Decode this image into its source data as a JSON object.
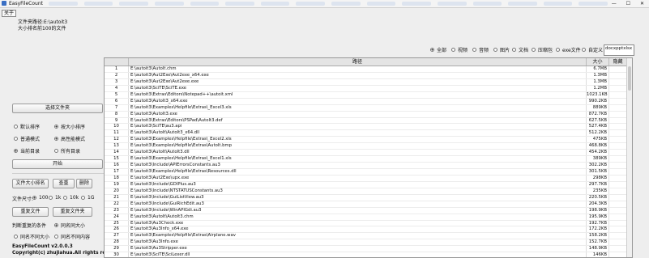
{
  "window": {
    "title": "EasyFileCount",
    "controls": [
      "—",
      "☐",
      "✕"
    ]
  },
  "menu": {
    "about": "关于"
  },
  "info": {
    "line1": "文件夹路径:E:\\autoit3",
    "line2": "大小排名前100的文件"
  },
  "left": {
    "select_folder": "选择文件夹",
    "sort_options": [
      {
        "label": "默认排序",
        "checked": false
      },
      {
        "label": "按大小排序",
        "checked": true
      }
    ],
    "mode_options": [
      {
        "label": "普通模式",
        "checked": false
      },
      {
        "label": "高性能模式",
        "checked": true
      }
    ],
    "scope_options": [
      {
        "label": "当前目录",
        "checked": true
      },
      {
        "label": "所有目录",
        "checked": false
      }
    ],
    "start": "开始",
    "size_rank": "文件大小排名",
    "dedupe": "查重",
    "delete": "删除",
    "file_size_label": "文件尺寸:",
    "size_options": [
      {
        "label": "100",
        "checked": true
      },
      {
        "label": "1k",
        "checked": false
      },
      {
        "label": "10k",
        "checked": false
      },
      {
        "label": "1G",
        "checked": false
      }
    ],
    "duplicate_files": "重复文件",
    "duplicate_folders": "重复文件夹",
    "dup_condition": "判断重复的条件",
    "dup_options": [
      {
        "label": "同名同大小",
        "checked": true
      },
      {
        "label": "同名不同大小",
        "checked": false
      },
      {
        "label": "同名不同内容",
        "checked": false
      }
    ],
    "version": "EasyFileCount v2.0.0.3",
    "copyright": "Copyright(c) zhujiahua.All rights reserved."
  },
  "filters": [
    {
      "label": "全部",
      "checked": true
    },
    {
      "label": "视频",
      "checked": false
    },
    {
      "label": "音频",
      "checked": false
    },
    {
      "label": "图片",
      "checked": false
    },
    {
      "label": "文档",
      "checked": false
    },
    {
      "label": "压缩包",
      "checked": false
    },
    {
      "label": "exe文件",
      "checked": false
    },
    {
      "label": "自定义",
      "checked": false
    }
  ],
  "ext_input": "docxpptxlsx",
  "table": {
    "headers": [
      "",
      "路径",
      "大小",
      "隐藏"
    ],
    "rows": [
      [
        "1",
        "E:\\autoit3\\AutoIt.chm",
        "6.7MB"
      ],
      [
        "2",
        "E:\\autoit3\\Aut2Exe\\Aut2exe_x64.exe",
        "1.3MB"
      ],
      [
        "3",
        "E:\\autoit3\\Aut2Exe\\Aut2exe.exe",
        "1.3MB"
      ],
      [
        "4",
        "E:\\autoit3\\SciTE\\SciTE.exe",
        "1.2MB"
      ],
      [
        "5",
        "E:\\autoit3\\Extras\\Editors\\Notepad++\\autoit.xml",
        "1023.1KB"
      ],
      [
        "6",
        "E:\\autoit3\\AutoIt3_x64.exe",
        "990.2KB"
      ],
      [
        "7",
        "E:\\autoit3\\Examples\\Helpfile\\Extras\\_Excel3.xls",
        "889KB"
      ],
      [
        "8",
        "E:\\autoit3\\AutoIt3.exe",
        "872.7KB"
      ],
      [
        "9",
        "E:\\autoit3\\Extras\\Editors\\PSPad\\AutoIt3.def",
        "627.5KB"
      ],
      [
        "10",
        "E:\\autoit3\\SciTE\\au3.api",
        "527.4KB"
      ],
      [
        "11",
        "E:\\autoit3\\AutoIt\\AutoIt3_x64.dll",
        "512.2KB"
      ],
      [
        "12",
        "E:\\autoit3\\Examples\\Helpfile\\Extras\\_Excel2.xls",
        "475KB"
      ],
      [
        "13",
        "E:\\autoit3\\Examples\\Helpfile\\Extras\\AutoIt.bmp",
        "468.8KB"
      ],
      [
        "14",
        "E:\\autoit3\\AutoIt\\AutoIt3.dll",
        "454.2KB"
      ],
      [
        "15",
        "E:\\autoit3\\Examples\\Helpfile\\Extras\\_Excel1.xls",
        "389KB"
      ],
      [
        "16",
        "E:\\autoit3\\Include\\APIErrorsConstants.au3",
        "302.2KB"
      ],
      [
        "17",
        "E:\\autoit3\\Examples\\Helpfile\\Extras\\Resources.dll",
        "301.5KB"
      ],
      [
        "18",
        "E:\\autoit3\\Aut2Exe\\upx.exe",
        "298KB"
      ],
      [
        "19",
        "E:\\autoit3\\Include\\GDIPlus.au3",
        "297.7KB"
      ],
      [
        "20",
        "E:\\autoit3\\Include\\NTSTATUSConstants.au3",
        "235KB"
      ],
      [
        "21",
        "E:\\autoit3\\Include\\GuiListView.au3",
        "220.5KB"
      ],
      [
        "22",
        "E:\\autoit3\\Include\\GuiRichEdit.au3",
        "204.3KB"
      ],
      [
        "23",
        "E:\\autoit3\\Include\\WinAPIGdi.au3",
        "198.9KB"
      ],
      [
        "24",
        "E:\\autoit3\\AutoIt\\AutoIt3.chm",
        "195.9KB"
      ],
      [
        "25",
        "E:\\autoit3\\Au3Check.exe",
        "192.7KB"
      ],
      [
        "26",
        "E:\\autoit3\\Au3Info_x64.exe",
        "172.2KB"
      ],
      [
        "27",
        "E:\\autoit3\\Examples\\Helpfile\\Extras\\Airplane.wav",
        "158.2KB"
      ],
      [
        "28",
        "E:\\autoit3\\Au3Info.exe",
        "152.7KB"
      ],
      [
        "29",
        "E:\\autoit3\\Au3Stripper.exe",
        "148.9KB"
      ],
      [
        "30",
        "E:\\autoit3\\SciTE\\SciLexer.dll",
        "146KB"
      ]
    ]
  }
}
